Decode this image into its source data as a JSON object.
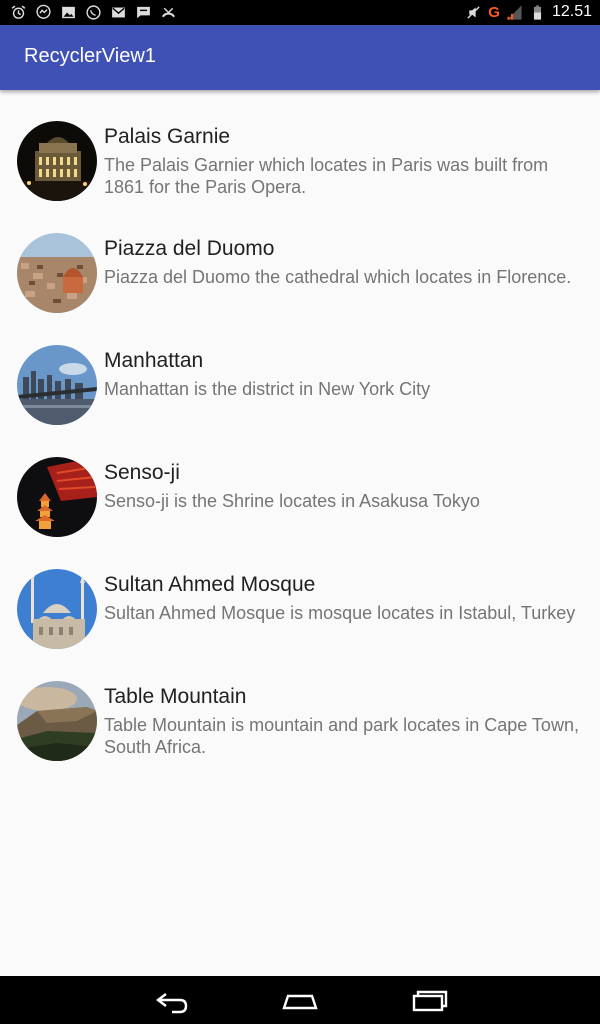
{
  "status_bar": {
    "time": "12.51",
    "network_label": "G",
    "left_icons": [
      "alarm-icon",
      "messenger-icon",
      "image-icon",
      "whatsapp-icon",
      "gmail-icon",
      "chat-icon",
      "missed-call-icon"
    ],
    "right_icons": [
      "mute-icon",
      "signal-icon",
      "battery-icon"
    ]
  },
  "app_bar": {
    "title": "RecyclerView1",
    "color": "#3f51b5"
  },
  "places": [
    {
      "title": "Palais Garnie",
      "description": "The Palais Garnier which locates in Paris was built from 1861 for the Paris Opera."
    },
    {
      "title": "Piazza del Duomo",
      "description": "Piazza del Duomo the cathedral which locates in Florence."
    },
    {
      "title": "Manhattan",
      "description": "Manhattan is the district in New York City"
    },
    {
      "title": "Senso-ji",
      "description": "Senso-ji is the Shrine locates in Asakusa Tokyo"
    },
    {
      "title": "Sultan Ahmed Mosque",
      "description": "Sultan Ahmed Mosque is mosque locates in Istabul, Turkey"
    },
    {
      "title": "Table Mountain",
      "description": "Table Mountain is mountain and park locates in Cape Town, South Africa."
    }
  ],
  "nav_bar": {
    "buttons": [
      "back-icon",
      "home-icon",
      "recents-icon"
    ]
  }
}
